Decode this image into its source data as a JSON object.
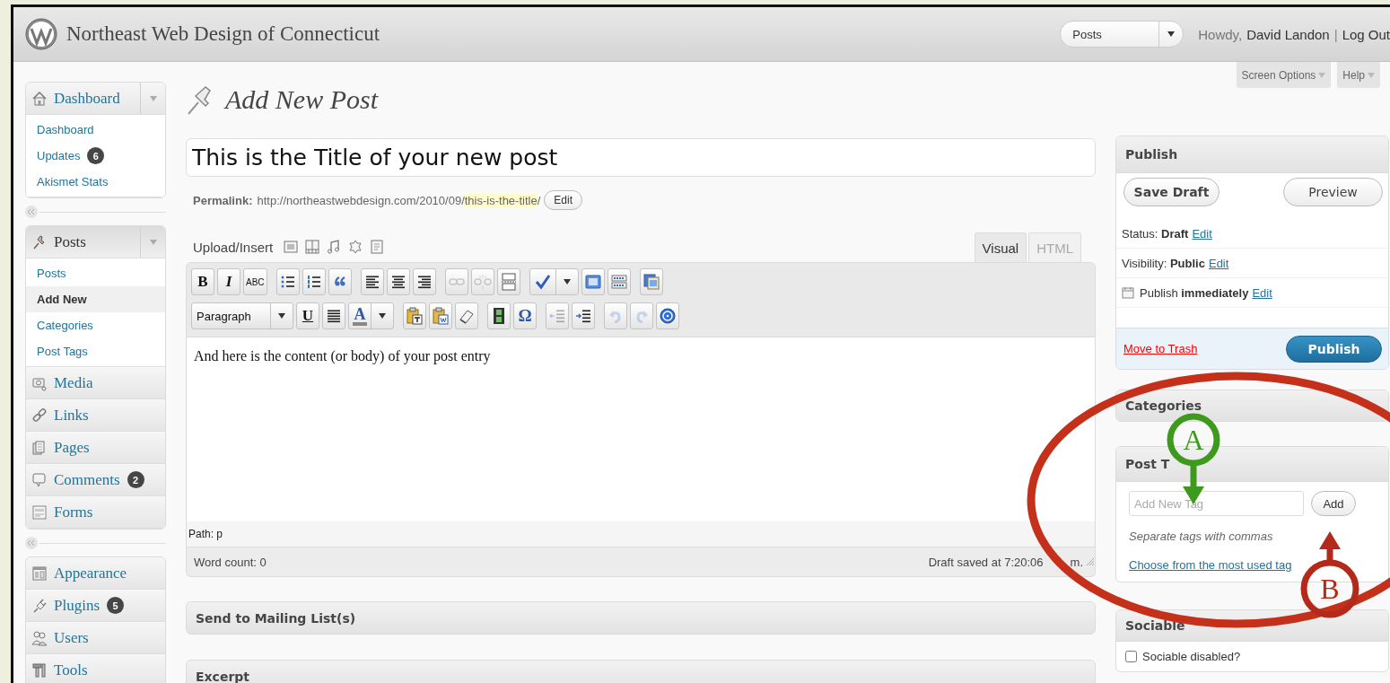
{
  "header": {
    "site_title": "Northeast Web Design of Connecticut",
    "favorites": {
      "value": "Posts"
    },
    "greeting": "Howdy,",
    "user": "David Landon",
    "separator": "|",
    "logout": "Log Out"
  },
  "screen_tabs": [
    {
      "label": "Screen Options"
    },
    {
      "label": "Help"
    }
  ],
  "sidebar": {
    "groups": [
      [
        {
          "label": "Dashboard",
          "current": false,
          "expanded": true,
          "children": [
            {
              "label": "Dashboard",
              "selected": false
            },
            {
              "label": "Updates",
              "badge": "6",
              "selected": false
            },
            {
              "label": "Akismet Stats",
              "selected": false
            }
          ]
        }
      ],
      [
        {
          "label": "Posts",
          "current": true,
          "expanded": true,
          "children": [
            {
              "label": "Posts",
              "selected": false
            },
            {
              "label": "Add New",
              "selected": true
            },
            {
              "label": "Categories",
              "selected": false
            },
            {
              "label": "Post Tags",
              "selected": false
            }
          ]
        },
        {
          "label": "Media",
          "current": false,
          "expanded": false
        },
        {
          "label": "Links",
          "current": false,
          "expanded": false
        },
        {
          "label": "Pages",
          "current": false,
          "expanded": false
        },
        {
          "label": "Comments",
          "badge": "2",
          "current": false,
          "expanded": false
        },
        {
          "label": "Forms",
          "current": false,
          "expanded": false
        }
      ],
      [
        {
          "label": "Appearance",
          "current": false,
          "expanded": false
        },
        {
          "label": "Plugins",
          "badge": "5",
          "current": false,
          "expanded": false
        },
        {
          "label": "Users",
          "current": false,
          "expanded": false
        },
        {
          "label": "Tools",
          "current": false,
          "expanded": false
        }
      ]
    ]
  },
  "page_title": "Add New Post",
  "post_title": {
    "value": "This is the Title of your new post"
  },
  "permalink": {
    "label": "Permalink:",
    "url": "http://northeastwebdesign.com/2010/09/",
    "slug": "this-is-the-title",
    "suffix": "/",
    "button": "Edit"
  },
  "upload_insert": {
    "label": "Upload/Insert"
  },
  "editor_tabs": [
    {
      "label": "Visual",
      "selected": true
    },
    {
      "label": "HTML",
      "selected": false
    }
  ],
  "toolbar_top": [
    {
      "kind": "bold",
      "label": "B",
      "disabled": false
    },
    {
      "kind": "italic",
      "label": "I",
      "disabled": false
    },
    {
      "kind": "strike",
      "label": "ABC",
      "disabled": false
    },
    {
      "kind": "bullets",
      "disabled": false
    },
    {
      "kind": "numbers",
      "disabled": false
    },
    {
      "kind": "quote",
      "disabled": false
    },
    {
      "kind": "align-left",
      "disabled": false
    },
    {
      "kind": "align-center",
      "disabled": false
    },
    {
      "kind": "align-right",
      "disabled": false
    },
    {
      "kind": "link",
      "disabled": true
    },
    {
      "kind": "unlink",
      "disabled": true
    },
    {
      "kind": "more",
      "disabled": false
    },
    {
      "kind": "spell",
      "disabled": false
    },
    {
      "kind": "fullscreen",
      "disabled": false
    },
    {
      "kind": "kitchen",
      "disabled": false
    },
    {
      "kind": "media",
      "disabled": false
    }
  ],
  "toolbar_bottom": [
    {
      "kind": "format",
      "label": "Paragraph",
      "disabled": false
    },
    {
      "kind": "underline",
      "label": "U",
      "disabled": false
    },
    {
      "kind": "justify",
      "disabled": false
    },
    {
      "kind": "color",
      "label": "A",
      "disabled": false
    },
    {
      "kind": "paste-text",
      "disabled": false
    },
    {
      "kind": "paste-word",
      "disabled": false
    },
    {
      "kind": "eraser",
      "disabled": false
    },
    {
      "kind": "video",
      "disabled": false
    },
    {
      "kind": "char",
      "label": "Ω",
      "disabled": false
    },
    {
      "kind": "outdent",
      "disabled": true
    },
    {
      "kind": "indent",
      "disabled": false
    },
    {
      "kind": "undo",
      "disabled": true
    },
    {
      "kind": "redo",
      "disabled": true
    },
    {
      "kind": "help",
      "disabled": false
    }
  ],
  "content": "And here is the content (or body) of your post entry",
  "path": "Path: p",
  "word_count": "Word count: 0",
  "draft_saved": [
    "Draft saved at 7:20:06",
    "m."
  ],
  "meta_boxes": [
    {
      "title": "Send to Mailing List(s)"
    },
    {
      "title": "Excerpt"
    }
  ],
  "publish": {
    "title": "Publish",
    "save_draft": "Save Draft",
    "preview": "Preview",
    "rows": [
      {
        "kind": "plain",
        "text": "Status: **Draft**",
        "link": "Edit"
      },
      {
        "kind": "plain",
        "text": "Visibility: **Public**",
        "link": "Edit"
      },
      {
        "kind": "calendar",
        "text": "Publish **immediately**",
        "link": "Edit"
      }
    ],
    "trash": "Move to Trash",
    "button": "Publish"
  },
  "categories": {
    "title": "Categories"
  },
  "post_tags": {
    "title": "Post T",
    "placeholder": "Add New Tag",
    "button": "Add",
    "hint": "Separate tags with commas",
    "link": "Choose from the most used tag"
  },
  "sociable": {
    "title": "Sociable",
    "checkbox": {
      "label": "Sociable disabled?",
      "checked": false
    }
  },
  "annotations": [
    {
      "kind": "ellipse",
      "color": "#c4301a"
    },
    {
      "kind": "marker",
      "label": "A",
      "color": "#3d9a1c"
    },
    {
      "kind": "marker",
      "label": "B",
      "color": "#b3291a"
    }
  ]
}
